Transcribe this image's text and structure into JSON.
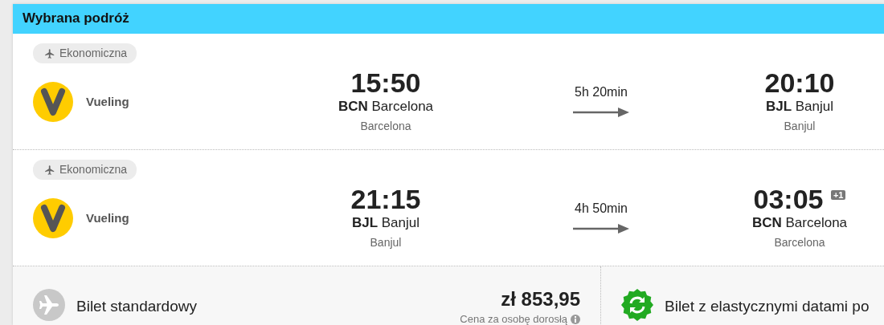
{
  "header": {
    "title": "Wybrana podróż"
  },
  "flights": [
    {
      "cabin": "Ekonomiczna",
      "airline": "Vueling",
      "departure": {
        "time": "15:50",
        "code": "BCN",
        "city": "Barcelona",
        "airport": "Barcelona"
      },
      "duration": "5h 20min",
      "arrival": {
        "time": "20:10",
        "code": "BJL",
        "city": "Banjul",
        "airport": "Banjul"
      }
    },
    {
      "cabin": "Ekonomiczna",
      "airline": "Vueling",
      "departure": {
        "time": "21:15",
        "code": "BJL",
        "city": "Banjul",
        "airport": "Banjul"
      },
      "duration": "4h 50min",
      "arrival": {
        "time": "03:05",
        "day_offset": "+1",
        "code": "BCN",
        "city": "Barcelona",
        "airport": "Barcelona"
      }
    }
  ],
  "fares": [
    {
      "kind": "standard",
      "name": "Bilet standardowy",
      "price": "zł 853,95",
      "price_note": "Cena za osobę dorosłą"
    },
    {
      "kind": "flexible",
      "name": "Bilet z elastycznymi datami po"
    }
  ]
}
